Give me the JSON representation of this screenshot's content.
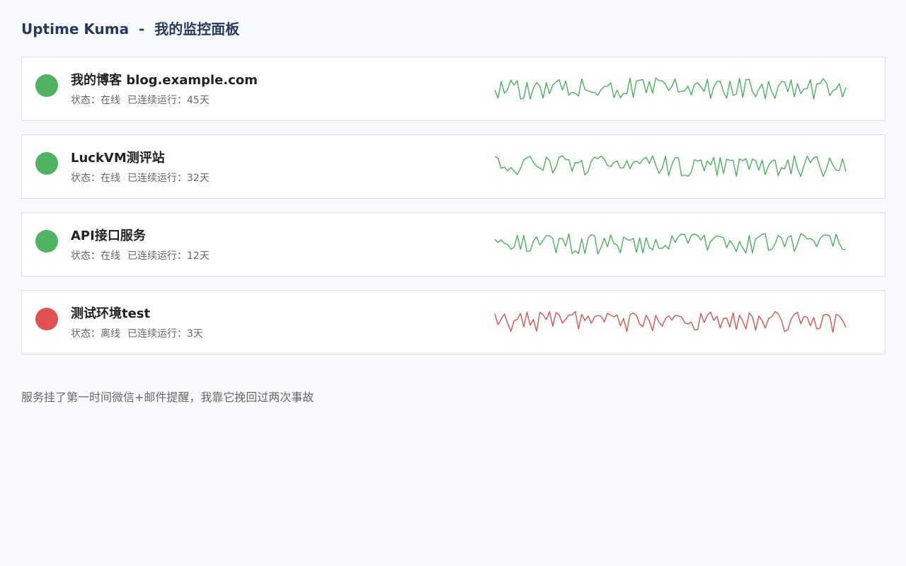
{
  "header": {
    "title": "Uptime Kuma  -  我的监控面板"
  },
  "monitors": [
    {
      "name": "我的博客 blog.example.com",
      "status_text": "状态：在线",
      "uptime_text": "已连续运行：45天",
      "status": "online",
      "color": "#4caf5f",
      "dot_color": "#4fb462"
    },
    {
      "name": "LuckVM测评站",
      "status_text": "状态：在线",
      "uptime_text": "已连续运行：32天",
      "status": "online",
      "color": "#4caf5f",
      "dot_color": "#4fb462"
    },
    {
      "name": "API接口服务",
      "status_text": "状态：在线",
      "uptime_text": "已连续运行：12天",
      "status": "online",
      "color": "#4caf5f",
      "dot_color": "#4fb462"
    },
    {
      "name": "测试环境test",
      "status_text": "状态：离线",
      "uptime_text": "已连续运行：3天",
      "status": "offline",
      "color": "#d9534f",
      "dot_color": "#e05252"
    }
  ],
  "footer": {
    "note": "服务挂了第一时间微信+邮件提醒，我靠它挽回过两次事故"
  }
}
